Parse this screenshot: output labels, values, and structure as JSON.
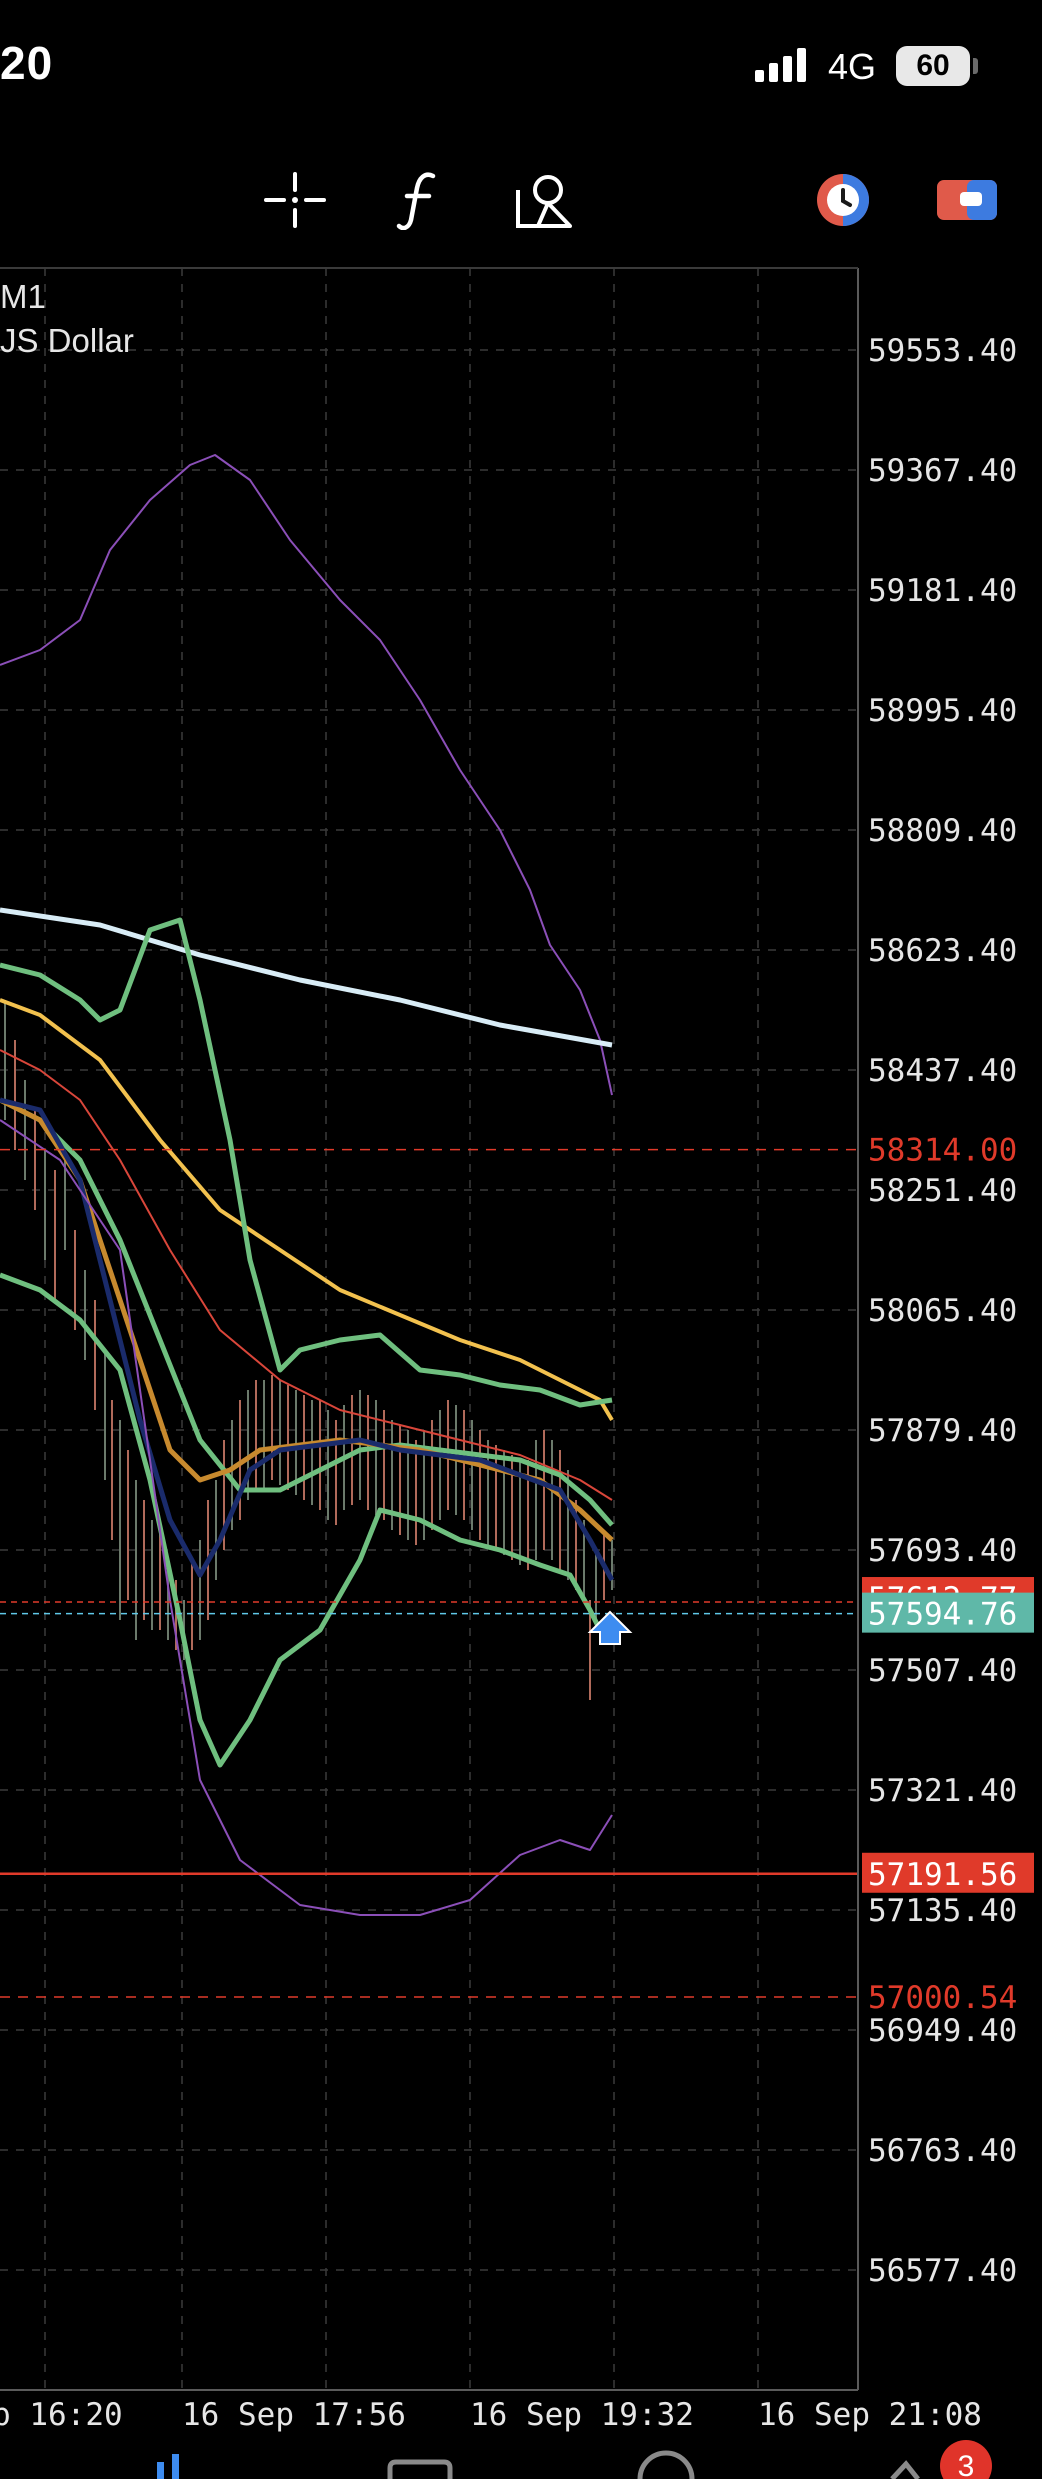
{
  "status_bar": {
    "time": "20",
    "network": "4G",
    "battery": "60"
  },
  "toolbar": {
    "icons": [
      "crosshair-icon",
      "function-icon",
      "objects-icon",
      "trade-mode-icon",
      "chart-type-icon"
    ]
  },
  "chart_info": {
    "timeframe": "M1",
    "symbol_desc": "JS Dollar"
  },
  "price_axis": {
    "ticks": [
      "59553.40",
      "59367.40",
      "59181.40",
      "58995.40",
      "58809.40",
      "58623.40",
      "58437.40",
      "58251.40",
      "58065.40",
      "57879.40",
      "57693.40",
      "57507.40",
      "57321.40",
      "57135.40",
      "56949.40",
      "56763.40",
      "56577.40"
    ],
    "tp_label": "58314.00",
    "current_label": "57594.76",
    "ask_label": "57612.77",
    "sl_label": "57191.56",
    "lower_label": "57000.54"
  },
  "time_axis": {
    "ticks": [
      "p 16:20",
      "16 Sep 17:56",
      "16 Sep 19:32",
      "16 Sep 21:08"
    ]
  },
  "colors": {
    "background": "#000000",
    "grid": "#3a3a3a",
    "bull_candle": "#6b7a6b",
    "bear_candle": "#b06a5a",
    "ma_white": "#d8ecf6",
    "ma_yellow": "#f2c14e",
    "ma_red": "#d9463a",
    "ma_orange": "#c88a2e",
    "ma_navy": "#1a2b6b",
    "bb_green": "#6fbf7f",
    "envelope_purple": "#8b4fb8",
    "current_badge": "#5fb8a8",
    "sl_badge": "#e03a2a",
    "arrow_blue": "#3d8cf0"
  },
  "bottom_tabs": {
    "badge_count": "3"
  }
}
